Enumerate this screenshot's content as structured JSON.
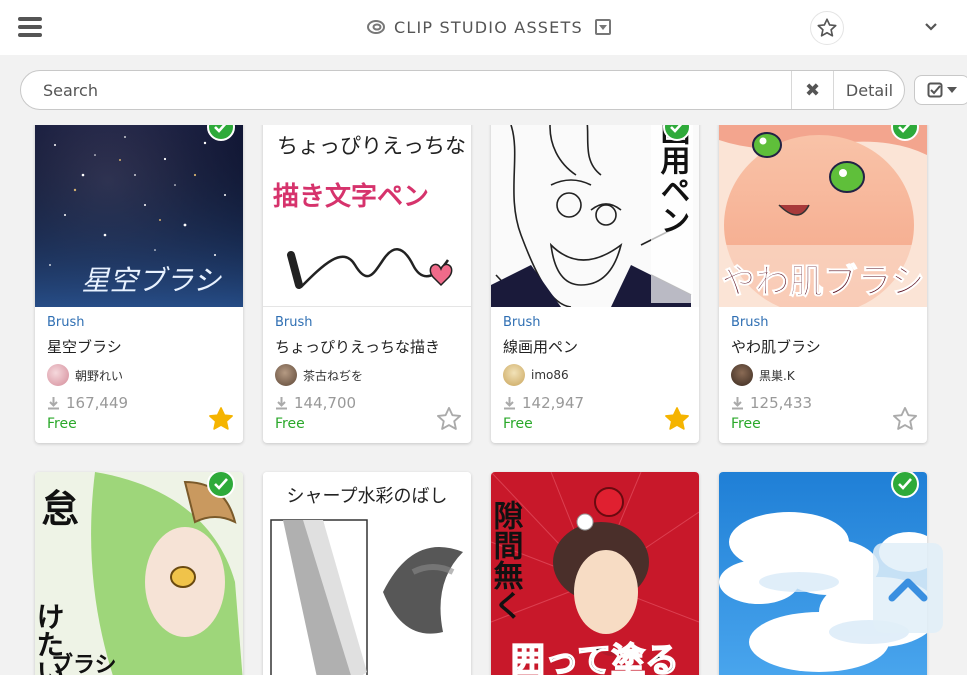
{
  "header": {
    "title": "CLIP STUDIO ASSETS"
  },
  "search": {
    "placeholder": "Search",
    "clear_label": "✖",
    "detail_label": "Detail"
  },
  "assets": [
    {
      "category": "Brush",
      "name": "星空ブラシ",
      "author": "朝野れい",
      "downloads": "167,449",
      "price": "Free",
      "favorited": true,
      "downloaded": true,
      "thumb_text": "星空ブラシ"
    },
    {
      "category": "Brush",
      "name": "ちょっぴりえっちな描き",
      "author": "茶古ねぢを",
      "downloads": "144,700",
      "price": "Free",
      "favorited": false,
      "downloaded": false,
      "thumb_text_1": "ちょっぴりえっちな",
      "thumb_text_2": "描き文字ペン"
    },
    {
      "category": "Brush",
      "name": "線画用ペン",
      "author": "imo86",
      "downloads": "142,947",
      "price": "Free",
      "favorited": true,
      "downloaded": true,
      "thumb_text": "線画用ペン"
    },
    {
      "category": "Brush",
      "name": "やわ肌ブラシ",
      "author": "黒巣.K",
      "downloads": "125,433",
      "price": "Free",
      "favorited": false,
      "downloaded": true,
      "thumb_text": "やわ肌ブラシ"
    },
    {
      "downloaded": true,
      "thumb_text_1": "怠",
      "thumb_text_2": "けたい",
      "thumb_text_3": "ブラシ"
    },
    {
      "downloaded": false,
      "thumb_text": "シャープ水彩のばし"
    },
    {
      "downloaded": false,
      "thumb_text_1": "隙間無く",
      "thumb_text_2": "囲って塗る"
    },
    {
      "downloaded": true
    }
  ],
  "colors": {
    "free": "#2aa82a",
    "category": "#2f6fb3",
    "check": "#2eaa3a",
    "star_on": "#f5b400"
  }
}
